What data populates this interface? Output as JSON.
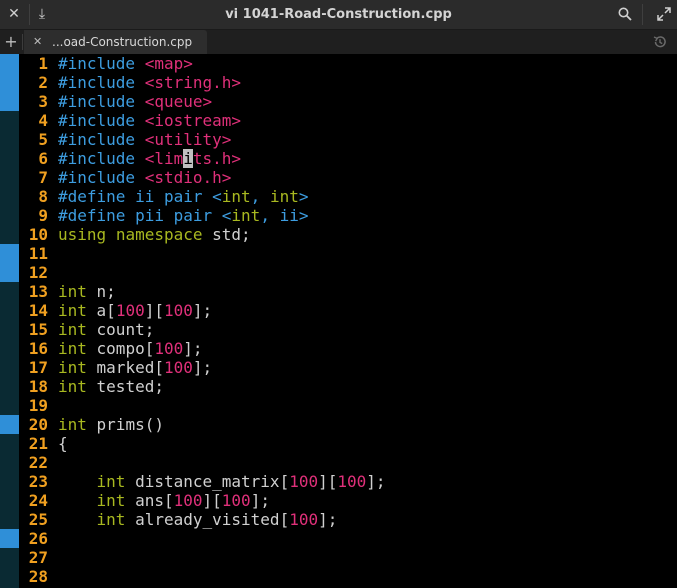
{
  "window": {
    "title": "vi 1041-Road-Construction.cpp",
    "buttons": {
      "close": "✕",
      "download": "⤓",
      "search": "search",
      "fullscreen": "fullscreen"
    }
  },
  "tabs": {
    "new_tab": "+",
    "items": [
      {
        "label": "...oad-Construction.cpp",
        "close": "✕",
        "active": true
      }
    ],
    "history": "history"
  },
  "gutter_marks": [
    {
      "from_line": 1,
      "to_line": 3
    },
    {
      "from_line": 11,
      "to_line": 12
    },
    {
      "from_line": 20,
      "to_line": 20
    },
    {
      "from_line": 26,
      "to_line": 26
    }
  ],
  "editor": {
    "cursor": {
      "line": 6,
      "column": 13
    },
    "lines": [
      {
        "n": "1",
        "tokens": [
          [
            "pp",
            "#include "
          ],
          [
            "str",
            "<map>"
          ]
        ]
      },
      {
        "n": "2",
        "tokens": [
          [
            "pp",
            "#include "
          ],
          [
            "str",
            "<string.h>"
          ]
        ]
      },
      {
        "n": "3",
        "tokens": [
          [
            "pp",
            "#include "
          ],
          [
            "str",
            "<queue>"
          ]
        ]
      },
      {
        "n": "4",
        "tokens": [
          [
            "pp",
            "#include "
          ],
          [
            "str",
            "<iostream>"
          ]
        ]
      },
      {
        "n": "5",
        "tokens": [
          [
            "pp",
            "#include "
          ],
          [
            "str",
            "<utility>"
          ]
        ]
      },
      {
        "n": "6",
        "tokens": [
          [
            "pp",
            "#include "
          ],
          [
            "str",
            "<lim"
          ],
          [
            "cursor",
            "i"
          ],
          [
            "str",
            "ts.h>"
          ]
        ]
      },
      {
        "n": "7",
        "tokens": [
          [
            "pp",
            "#include "
          ],
          [
            "str",
            "<stdio.h>"
          ]
        ]
      },
      {
        "n": "8",
        "tokens": [
          [
            "pp",
            "#define ii pair "
          ],
          [
            "pp",
            "<"
          ],
          [
            "ty",
            "int"
          ],
          [
            "pp",
            ", "
          ],
          [
            "ty",
            "int"
          ],
          [
            "pp",
            ">"
          ]
        ]
      },
      {
        "n": "9",
        "tokens": [
          [
            "pp",
            "#define pii pair "
          ],
          [
            "pp",
            "<"
          ],
          [
            "ty",
            "int"
          ],
          [
            "pp",
            ", ii>"
          ]
        ]
      },
      {
        "n": "10",
        "tokens": [
          [
            "kw",
            "using"
          ],
          [
            "plain",
            " "
          ],
          [
            "kw",
            "namespace"
          ],
          [
            "plain",
            " std;"
          ]
        ]
      },
      {
        "n": "11",
        "tokens": []
      },
      {
        "n": "12",
        "tokens": []
      },
      {
        "n": "13",
        "tokens": [
          [
            "ty",
            "int"
          ],
          [
            "plain",
            " n;"
          ]
        ]
      },
      {
        "n": "14",
        "tokens": [
          [
            "ty",
            "int"
          ],
          [
            "plain",
            " a["
          ],
          [
            "num",
            "100"
          ],
          [
            "plain",
            "]["
          ],
          [
            "num",
            "100"
          ],
          [
            "plain",
            "];"
          ]
        ]
      },
      {
        "n": "15",
        "tokens": [
          [
            "ty",
            "int"
          ],
          [
            "plain",
            " count;"
          ]
        ]
      },
      {
        "n": "16",
        "tokens": [
          [
            "ty",
            "int"
          ],
          [
            "plain",
            " compo["
          ],
          [
            "num",
            "100"
          ],
          [
            "plain",
            "];"
          ]
        ]
      },
      {
        "n": "17",
        "tokens": [
          [
            "ty",
            "int"
          ],
          [
            "plain",
            " marked["
          ],
          [
            "num",
            "100"
          ],
          [
            "plain",
            "];"
          ]
        ]
      },
      {
        "n": "18",
        "tokens": [
          [
            "ty",
            "int"
          ],
          [
            "plain",
            " tested;"
          ]
        ]
      },
      {
        "n": "19",
        "tokens": []
      },
      {
        "n": "20",
        "tokens": [
          [
            "ty",
            "int"
          ],
          [
            "plain",
            " prims()"
          ]
        ]
      },
      {
        "n": "21",
        "tokens": [
          [
            "plain",
            "{"
          ]
        ]
      },
      {
        "n": "22",
        "tokens": []
      },
      {
        "n": "23",
        "tokens": [
          [
            "plain",
            "    "
          ],
          [
            "ty",
            "int"
          ],
          [
            "plain",
            " distance_matrix["
          ],
          [
            "num",
            "100"
          ],
          [
            "plain",
            "]["
          ],
          [
            "num",
            "100"
          ],
          [
            "plain",
            "];"
          ]
        ]
      },
      {
        "n": "24",
        "tokens": [
          [
            "plain",
            "    "
          ],
          [
            "ty",
            "int"
          ],
          [
            "plain",
            " ans["
          ],
          [
            "num",
            "100"
          ],
          [
            "plain",
            "]["
          ],
          [
            "num",
            "100"
          ],
          [
            "plain",
            "];"
          ]
        ]
      },
      {
        "n": "25",
        "tokens": [
          [
            "plain",
            "    "
          ],
          [
            "ty",
            "int"
          ],
          [
            "plain",
            " already_visited["
          ],
          [
            "num",
            "100"
          ],
          [
            "plain",
            "];"
          ]
        ]
      },
      {
        "n": "26",
        "tokens": []
      },
      {
        "n": "27",
        "tokens": []
      },
      {
        "n": "28",
        "tokens": []
      }
    ]
  },
  "colors": {
    "preprocessor": "#3d9de0",
    "string": "#e0307a",
    "keyword": "#a8b820",
    "line_number": "#f0a020",
    "gutter_mark": "#2f8fd8",
    "background": "#000000"
  }
}
